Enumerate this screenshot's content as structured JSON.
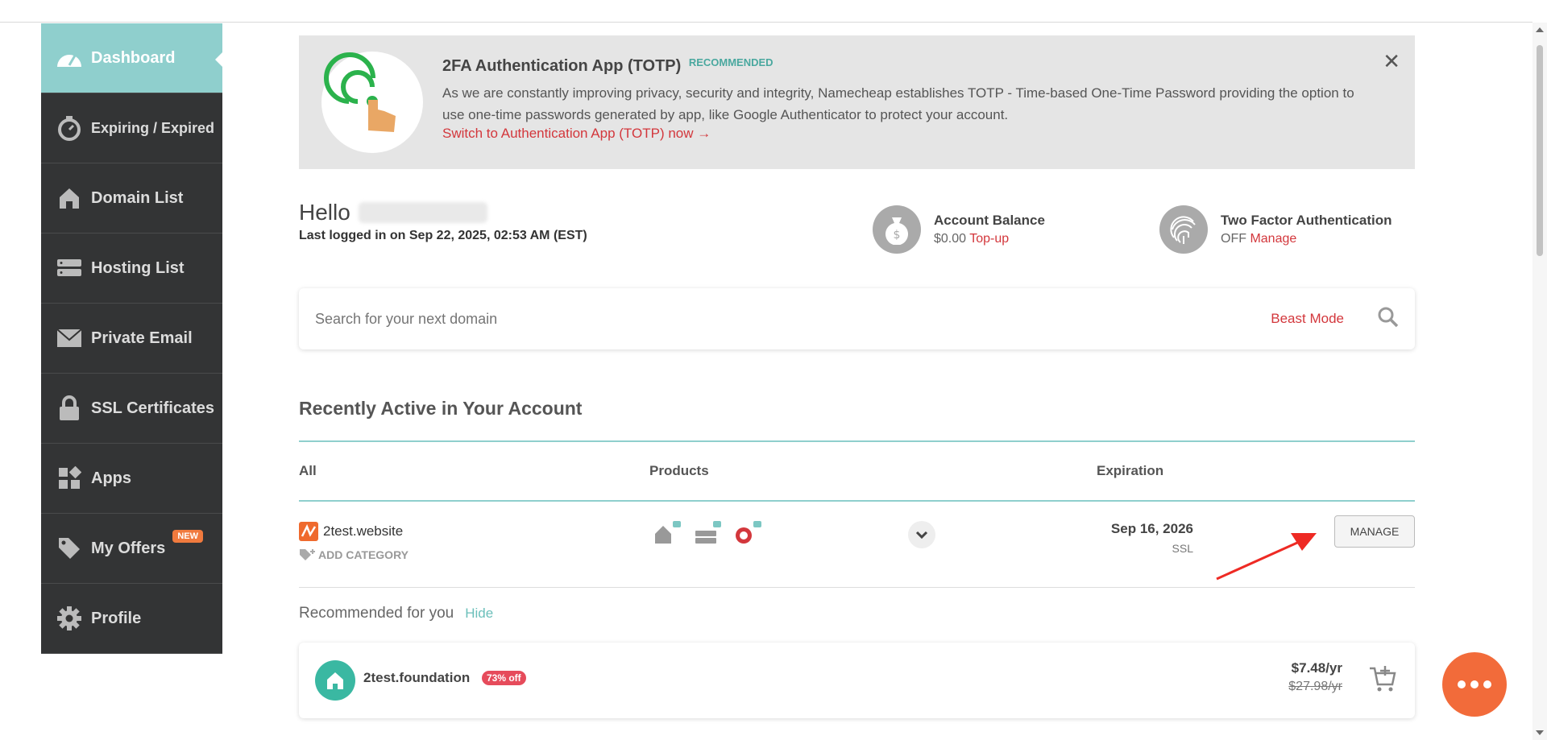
{
  "sidebar": {
    "items": [
      {
        "label": "Dashboard",
        "icon": "dashboard-gauge-icon"
      },
      {
        "label": "Expiring / Expired",
        "icon": "stopwatch-icon"
      },
      {
        "label": "Domain List",
        "icon": "house-icon"
      },
      {
        "label": "Hosting List",
        "icon": "server-icon"
      },
      {
        "label": "Private Email",
        "icon": "envelope-icon"
      },
      {
        "label": "SSL Certificates",
        "icon": "lock-icon"
      },
      {
        "label": "Apps",
        "icon": "apps-grid-icon"
      },
      {
        "label": "My Offers",
        "icon": "tag-icon",
        "badge": "NEW"
      },
      {
        "label": "Profile",
        "icon": "gear-icon"
      }
    ]
  },
  "banner": {
    "title": "2FA Authentication App (TOTP)",
    "tag": "RECOMMENDED",
    "description": "As we are constantly improving privacy, security and integrity, Namecheap establishes TOTP - Time-based One-Time Password providing the option to use one-time passwords generated by app, like Google Authenticator to protect your account.",
    "link": "Switch to Authentication App (TOTP) now →",
    "close": "✕"
  },
  "greeting": {
    "hello": "Hello",
    "last_login": "Last logged in on Sep 22, 2025, 02:53 AM (EST)"
  },
  "balance": {
    "label": "Account Balance",
    "value": "$0.00",
    "action": "Top-up"
  },
  "twofa": {
    "label": "Two Factor Authentication",
    "value": "OFF",
    "action": "Manage"
  },
  "search": {
    "placeholder": "Search for your next domain",
    "beast_mode": "Beast Mode"
  },
  "recent": {
    "title": "Recently Active in Your Account",
    "columns": {
      "all": "All",
      "products": "Products",
      "expiration": "Expiration"
    },
    "row": {
      "domain": "2test.website",
      "add_category": "ADD CATEGORY",
      "expiration": "Sep 16, 2026",
      "type": "SSL",
      "manage": "MANAGE"
    }
  },
  "recommended": {
    "title": "Recommended for you",
    "hide": "Hide",
    "item": {
      "domain": "2test.foundation",
      "discount": "73% off",
      "price": "$7.48/yr",
      "old_price": "$27.98/yr"
    }
  },
  "colors": {
    "accent": "#8fcfcd",
    "brand_red": "#d3373c",
    "sidebar": "#333435",
    "chat": "#f26b3a"
  }
}
